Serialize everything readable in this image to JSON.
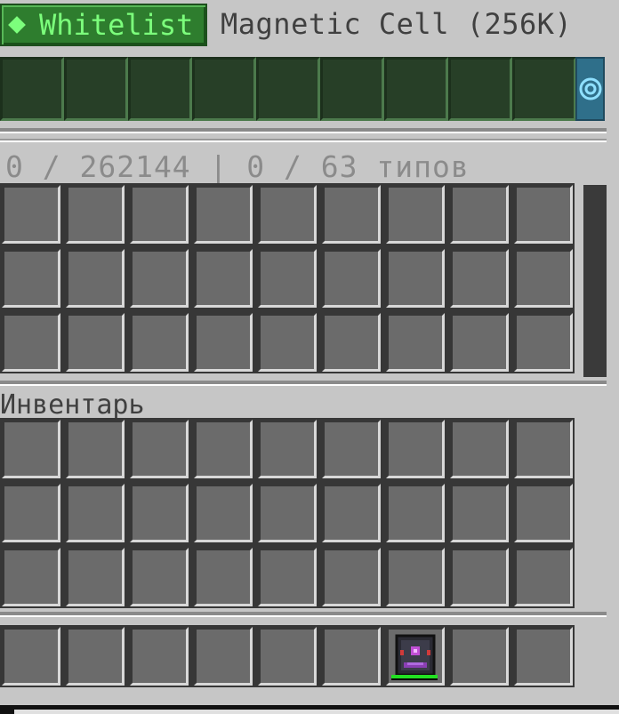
{
  "header": {
    "mode_button_label": "Whitelist",
    "cell_name": "Magnetic Cell (256K)"
  },
  "filter": {
    "slot_count": 9,
    "side_tab_icon": "magnet-toggle-icon"
  },
  "storage": {
    "stats_text": "0 / 262144 | 0 / 63 типов",
    "rows": 3,
    "cols": 9
  },
  "inventory": {
    "label": "Инвентарь",
    "rows": 3,
    "cols": 9
  },
  "hotbar": {
    "cols": 9,
    "item_slot_index": 6,
    "item_icon": "me-cell-item-icon",
    "item_durability_fraction": 1.0
  },
  "colors": {
    "whitelist_green": "#2e7d2e",
    "filter_bg": "#2f4f2f",
    "slot_gray": "#6b6b6b",
    "side_tab_blue": "#2f6f8a"
  }
}
